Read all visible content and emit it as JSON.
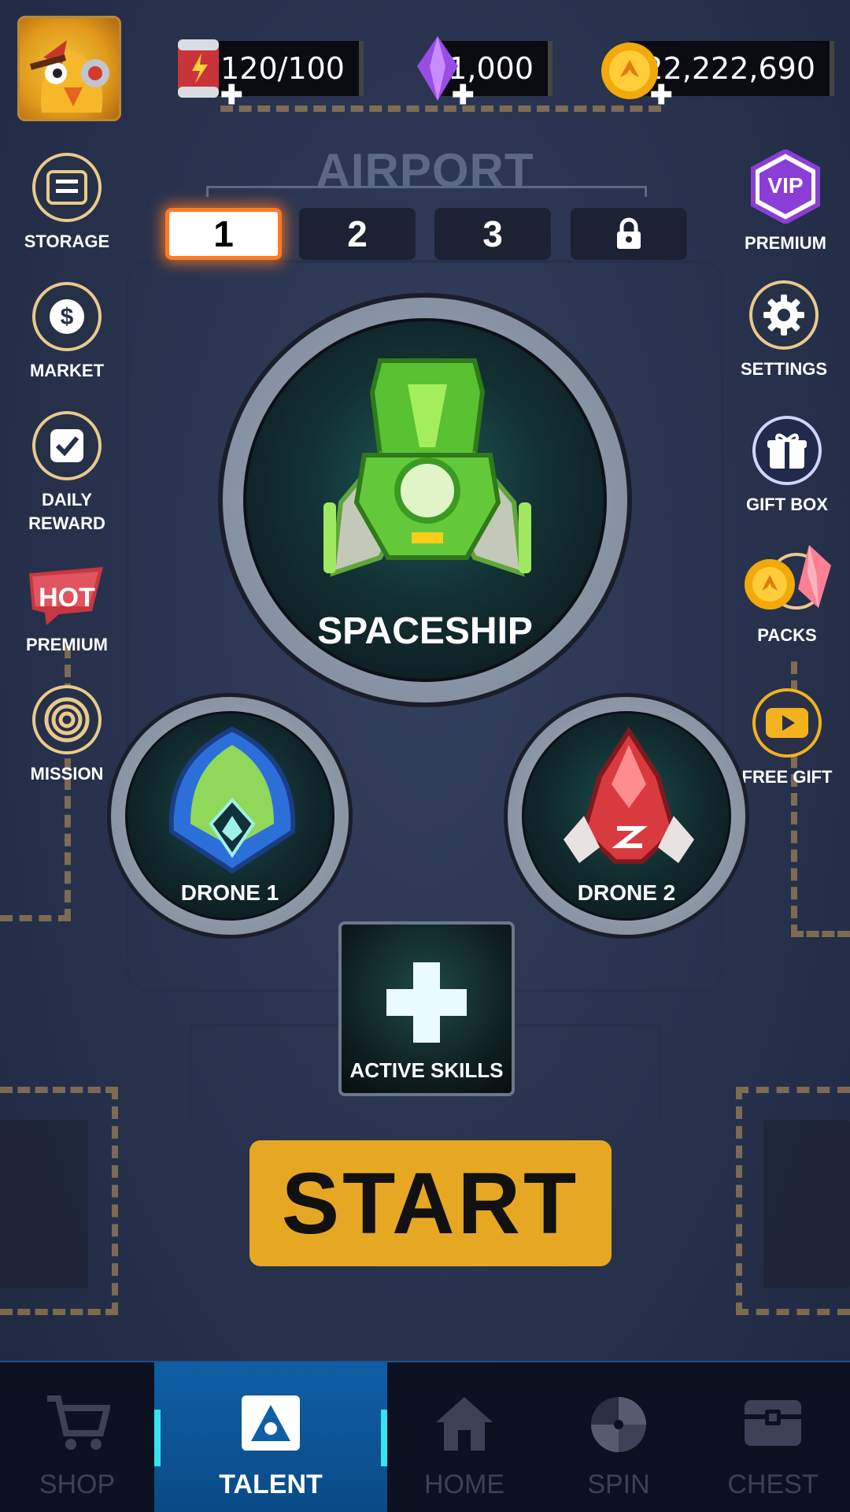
{
  "resources": {
    "energy": "120/100",
    "gems": "1,000",
    "coins": "222,222,690"
  },
  "airport": {
    "title": "AIRPORT",
    "tabs": [
      "1",
      "2",
      "3"
    ]
  },
  "left_menu": {
    "storage": "STORAGE",
    "market": "MARKET",
    "daily_reward": "DAILY\nREWARD",
    "hot_badge": "HOT",
    "premium": "PREMIUM",
    "mission": "MISSION"
  },
  "right_menu": {
    "vip_badge": "VIP",
    "premium": "PREMIUM",
    "settings": "SETTINGS",
    "gift_box": "GIFT BOX",
    "packs": "PACKS",
    "free_gift": "FREE GIFT"
  },
  "hangar": {
    "spaceship": "SPACESHIP",
    "drone1": "DRONE 1",
    "drone2": "DRONE 2",
    "active_skills": "ACTIVE SKILLS"
  },
  "start_label": "START",
  "nav": {
    "items": [
      "SHOP",
      "TALENT",
      "HOME",
      "SPIN",
      "CHEST"
    ],
    "active": "TALENT"
  },
  "colors": {
    "accent_start": "#e6a722",
    "tab_active_glow": "#ff7a22",
    "nav_active": "#0f5fa6",
    "coin": "#f2a90a",
    "gem": "#9b4be6"
  }
}
